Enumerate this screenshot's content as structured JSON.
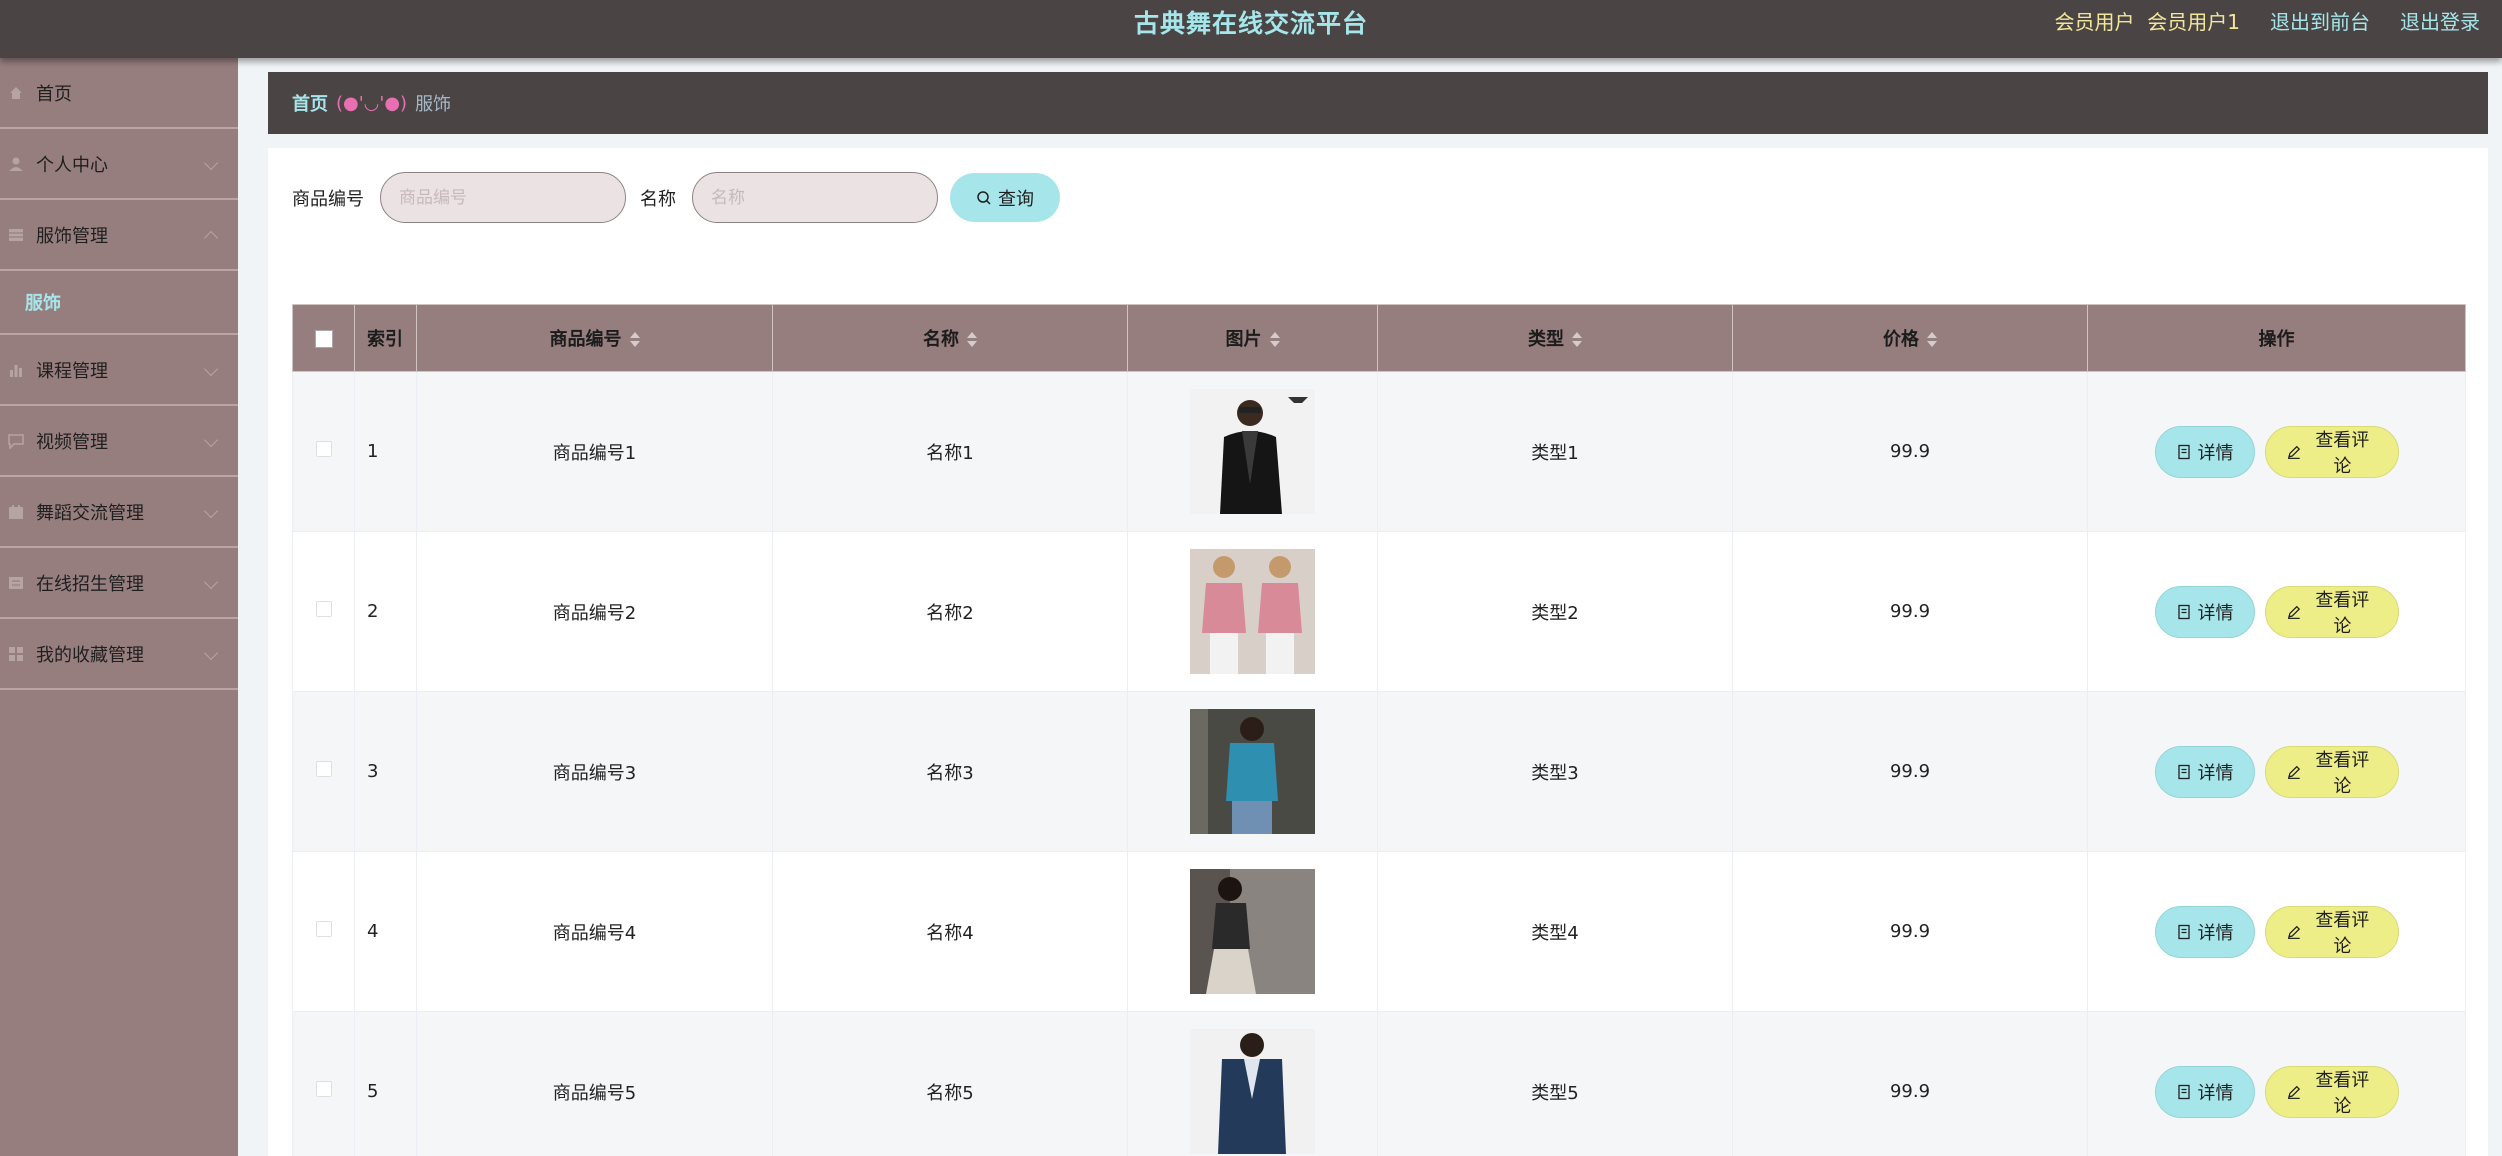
{
  "header": {
    "title": "古典舞在线交流平台",
    "user_label": "会员用户",
    "user_name": "会员用户1",
    "to_front": "退出到前台",
    "logout": "退出登录"
  },
  "sidebar": {
    "items": [
      {
        "label": "首页",
        "icon": "home-icon"
      },
      {
        "label": "个人中心",
        "icon": "user-icon"
      },
      {
        "label": "服饰管理",
        "icon": "table-icon",
        "expanded": true,
        "children": [
          {
            "label": "服饰"
          }
        ]
      },
      {
        "label": "课程管理",
        "icon": "chart-icon"
      },
      {
        "label": "视频管理",
        "icon": "message-icon"
      },
      {
        "label": "舞蹈交流管理",
        "icon": "calendar-icon"
      },
      {
        "label": "在线招生管理",
        "icon": "list-icon"
      },
      {
        "label": "我的收藏管理",
        "icon": "grid-icon"
      }
    ]
  },
  "breadcrumb": {
    "home": "首页",
    "separator": "(●'◡'●)",
    "current": "服饰"
  },
  "search": {
    "code_label": "商品编号",
    "code_placeholder": "商品编号",
    "name_label": "名称",
    "name_placeholder": "名称",
    "query_button": "查询"
  },
  "table": {
    "columns": [
      "索引",
      "商品编号",
      "名称",
      "图片",
      "类型",
      "价格",
      "操作"
    ],
    "rows": [
      {
        "index": "1",
        "code": "商品编号1",
        "name": "名称1",
        "image": "jacket-man-photo",
        "type": "类型1",
        "price": "99.9"
      },
      {
        "index": "2",
        "code": "商品编号2",
        "name": "名称2",
        "image": "pink-tshirt-photo",
        "type": "类型2",
        "price": "99.9"
      },
      {
        "index": "3",
        "code": "商品编号3",
        "name": "名称3",
        "image": "blue-sweater-photo",
        "type": "类型3",
        "price": "99.9"
      },
      {
        "index": "4",
        "code": "商品编号4",
        "name": "名称4",
        "image": "grey-dress-photo",
        "type": "类型4",
        "price": "99.9"
      },
      {
        "index": "5",
        "code": "商品编号5",
        "name": "名称5",
        "image": "navy-suit-photo",
        "type": "类型5",
        "price": "99.9"
      }
    ],
    "detail_label": "详情",
    "comment_label": "查看评论"
  },
  "colors": {
    "topbar": "#4a4444",
    "sidebar": "#977e7e",
    "accent_cyan": "#a6e6ea",
    "accent_yellow": "#eeee88",
    "user_text": "#f3e89a"
  }
}
